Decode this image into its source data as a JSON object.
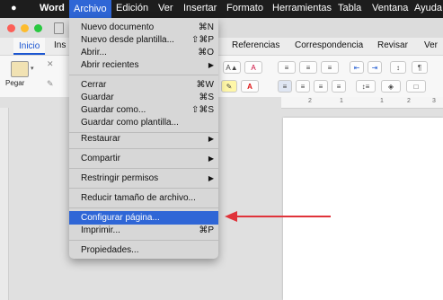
{
  "menubar": {
    "apple": "",
    "items": [
      "Word",
      "Archivo",
      "Edición",
      "Ver",
      "Insertar",
      "Formato",
      "Herramientas",
      "Tabla",
      "Ventana",
      "Ayuda"
    ]
  },
  "ribbon_tabs": [
    "Inicio",
    "Ins",
    "Referencias",
    "Correspondencia",
    "Revisar",
    "Ver"
  ],
  "ribbon": {
    "paste_label": "Pegar"
  },
  "menu": {
    "items": [
      {
        "label": "Nuevo documento",
        "shortcut": "⌘N"
      },
      {
        "label": "Nuevo desde plantilla...",
        "shortcut": "⇧⌘P"
      },
      {
        "label": "Abrir...",
        "shortcut": "⌘O"
      },
      {
        "label": "Abrir recientes",
        "shortcut": "▶"
      },
      {
        "label": "Cerrar",
        "shortcut": "⌘W"
      },
      {
        "label": "Guardar",
        "shortcut": "⌘S"
      },
      {
        "label": "Guardar como...",
        "shortcut": "⇧⌘S"
      },
      {
        "label": "Guardar como plantilla...",
        "shortcut": ""
      },
      {
        "label": "Restaurar",
        "shortcut": "▶"
      },
      {
        "label": "Compartir",
        "shortcut": "▶"
      },
      {
        "label": "Restringir permisos",
        "shortcut": "▶"
      },
      {
        "label": "Reducir tamaño de archivo...",
        "shortcut": ""
      },
      {
        "label": "Configurar página...",
        "shortcut": ""
      },
      {
        "label": "Imprimir...",
        "shortcut": "⌘P"
      },
      {
        "label": "Propiedades...",
        "shortcut": ""
      }
    ],
    "highlighted": "Configurar página..."
  },
  "colors": {
    "highlight": "#2f66d6",
    "arrow": "#e0333a",
    "close": "#fc5f57",
    "minimize": "#fdbc2e",
    "zoom": "#29c840"
  }
}
